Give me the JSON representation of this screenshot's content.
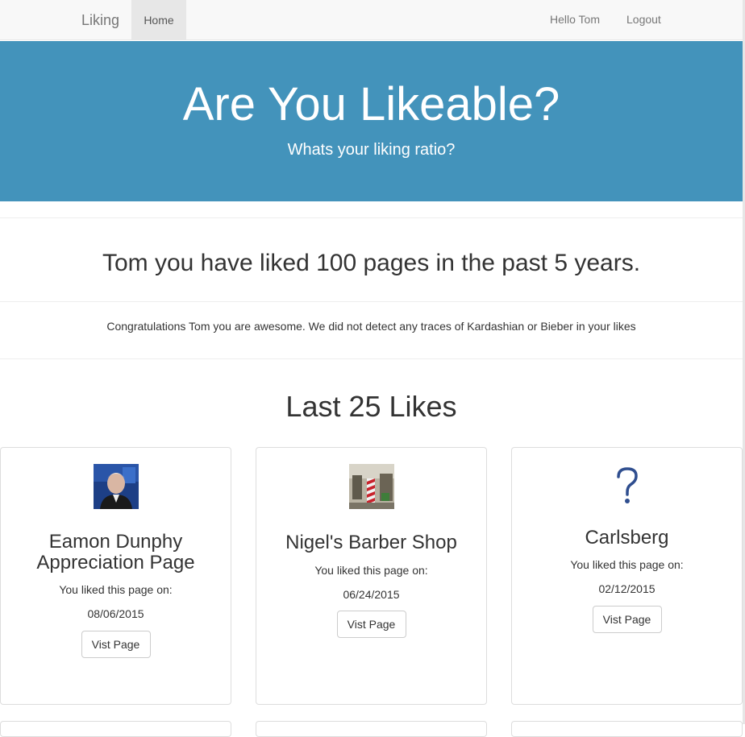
{
  "navbar": {
    "brand": "Liking",
    "home": "Home",
    "hello": "Hello Tom",
    "logout": "Logout"
  },
  "jumbotron": {
    "title": "Are You Likeable?",
    "subtitle": "Whats your liking ratio?",
    "background": "#4393bb"
  },
  "summary": {
    "headline": "Tom you have liked 100 pages in the past 5 years.",
    "message": "Congratulations Tom you are awesome. We did not detect any traces of Kardashian or Bieber in your likes"
  },
  "likes": {
    "section_title": "Last 25 Likes",
    "liked_on_label": "You liked this page on:",
    "button_label": "Vist Page",
    "cards": [
      {
        "title": "Eamon Dunphy Appreciation Page",
        "date": "08/06/2015",
        "image": "portrait-photo"
      },
      {
        "title": "Nigel's Barber Shop",
        "date": "06/24/2015",
        "image": "barber-shop-photo"
      },
      {
        "title": "Carlsberg",
        "date": "02/12/2015",
        "image": "question-mark-icon"
      }
    ]
  }
}
